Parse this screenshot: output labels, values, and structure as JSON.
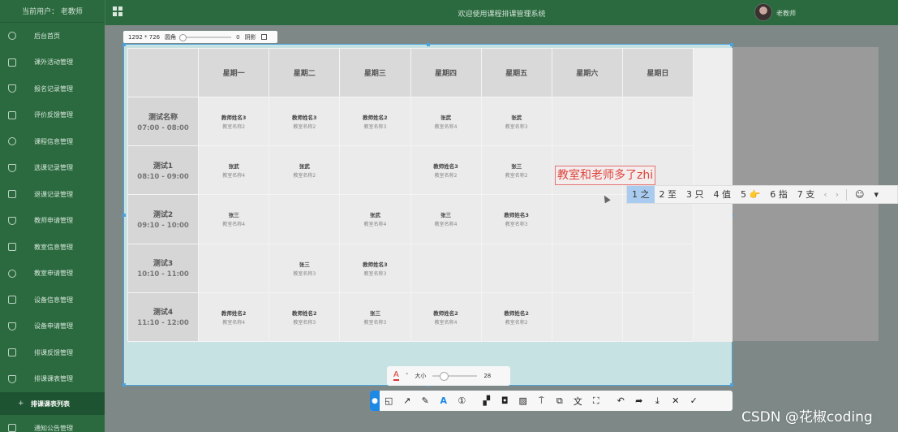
{
  "sidebar": {
    "current_user_label": "当前用户：  老教师",
    "items": [
      {
        "label": "后台首页",
        "icon": "home-icon"
      },
      {
        "label": "课外活动管理",
        "icon": "doc-icon"
      },
      {
        "label": "报名记录管理",
        "icon": "shield-icon"
      },
      {
        "label": "评价反馈管理",
        "icon": "columns-icon"
      },
      {
        "label": "课程信息管理",
        "icon": "circle-icon"
      },
      {
        "label": "选课记录管理",
        "icon": "shield-icon"
      },
      {
        "label": "退课记录管理",
        "icon": "doc-icon"
      },
      {
        "label": "教师申请管理",
        "icon": "shield-icon"
      },
      {
        "label": "教室信息管理",
        "icon": "columns-icon"
      },
      {
        "label": "教室申请管理",
        "icon": "circle-icon"
      },
      {
        "label": "设备信息管理",
        "icon": "columns-icon"
      },
      {
        "label": "设备申请管理",
        "icon": "shield-icon"
      },
      {
        "label": "排课反馈管理",
        "icon": "doc-icon"
      },
      {
        "label": "排课课表管理",
        "icon": "shield-icon"
      }
    ],
    "sub_item": {
      "prefix": "+",
      "label": "排课课表列表"
    },
    "last_item": {
      "label": "通知公告管理",
      "icon": "columns-icon"
    }
  },
  "topbar": {
    "title": "欢迎使用课程排课管理系统",
    "user": "老教师"
  },
  "sizebar": {
    "dimensions": "1292 * 726",
    "radius_label": "圆角",
    "radius_value": "0",
    "shadow_label": "阴影"
  },
  "schedule": {
    "days": [
      "星期一",
      "星期二",
      "星期三",
      "星期四",
      "星期五",
      "星期六",
      "星期日"
    ],
    "rows": [
      {
        "name": "测试名称",
        "time": "07:00 - 08:00",
        "cells": [
          {
            "teacher": "教师姓名3",
            "room": "教室名称2"
          },
          {
            "teacher": "教师姓名3",
            "room": "教室名称2"
          },
          {
            "teacher": "教师姓名2",
            "room": "教室名称3"
          },
          {
            "teacher": "张武",
            "room": "教室名称4"
          },
          {
            "teacher": "张武",
            "room": "教室名称3"
          },
          {
            "teacher": "",
            "room": ""
          },
          {
            "teacher": "",
            "room": ""
          }
        ]
      },
      {
        "name": "测试1",
        "time": "08:10 - 09:00",
        "cells": [
          {
            "teacher": "张武",
            "room": "教室名称4"
          },
          {
            "teacher": "张武",
            "room": "教室名称2"
          },
          {
            "teacher": "",
            "room": ""
          },
          {
            "teacher": "教师姓名3",
            "room": "教室名称2"
          },
          {
            "teacher": "张三",
            "room": "教室名称2"
          },
          {
            "teacher": "",
            "room": ""
          },
          {
            "teacher": "",
            "room": ""
          }
        ]
      },
      {
        "name": "测试2",
        "time": "09:10 - 10:00",
        "cells": [
          {
            "teacher": "张三",
            "room": "教室名称4"
          },
          {
            "teacher": "",
            "room": ""
          },
          {
            "teacher": "张武",
            "room": "教室名称4"
          },
          {
            "teacher": "张三",
            "room": "教室名称4"
          },
          {
            "teacher": "教师姓名3",
            "room": "教室名称3"
          },
          {
            "teacher": "",
            "room": ""
          },
          {
            "teacher": "",
            "room": ""
          }
        ]
      },
      {
        "name": "测试3",
        "time": "10:10 - 11:00",
        "cells": [
          {
            "teacher": "",
            "room": ""
          },
          {
            "teacher": "张三",
            "room": "教室名称3"
          },
          {
            "teacher": "教师姓名3",
            "room": "教室名称3"
          },
          {
            "teacher": "",
            "room": ""
          },
          {
            "teacher": "",
            "room": ""
          },
          {
            "teacher": "",
            "room": ""
          },
          {
            "teacher": "",
            "room": ""
          }
        ]
      },
      {
        "name": "测试4",
        "time": "11:10 - 12:00",
        "cells": [
          {
            "teacher": "教师姓名2",
            "room": "教室名称4"
          },
          {
            "teacher": "教师姓名2",
            "room": "教室名称3"
          },
          {
            "teacher": "张三",
            "room": "教室名称3"
          },
          {
            "teacher": "教师姓名2",
            "room": "教室名称4"
          },
          {
            "teacher": "教师姓名2",
            "room": "教室名称2"
          },
          {
            "teacher": "",
            "room": ""
          },
          {
            "teacher": "",
            "room": ""
          }
        ]
      }
    ]
  },
  "annotation": {
    "typed_text": "教室和老师多了zhi"
  },
  "ime": {
    "candidates": [
      "1 之",
      "2 至",
      "3 只",
      "4 值",
      "5 👉",
      "6 指",
      "7 支"
    ],
    "prev": "‹",
    "next": "›",
    "emoji": "☺",
    "menu": "▾"
  },
  "fontbar": {
    "color_label": "A",
    "size_label": "大小",
    "size_value": "28"
  },
  "tools": [
    {
      "name": "pin-icon",
      "glyph": "●"
    },
    {
      "name": "shape-icon",
      "glyph": "◱"
    },
    {
      "name": "arrow-icon",
      "glyph": "↗"
    },
    {
      "name": "pen-icon",
      "glyph": "✎"
    },
    {
      "name": "text-icon",
      "glyph": "A"
    },
    {
      "name": "number-icon",
      "glyph": "①"
    },
    {
      "name": "mosaic-icon",
      "glyph": "▞"
    },
    {
      "name": "blur-icon",
      "glyph": "◘"
    },
    {
      "name": "hatch-icon",
      "glyph": "▨"
    },
    {
      "name": "stamp-icon",
      "glyph": "⍑"
    },
    {
      "name": "image-icon",
      "glyph": "⧉"
    },
    {
      "name": "translate-icon",
      "glyph": "文"
    },
    {
      "name": "ocr-icon",
      "glyph": "⛶"
    },
    {
      "name": "undo-icon",
      "glyph": "↶"
    },
    {
      "name": "share-icon",
      "glyph": "➦"
    },
    {
      "name": "download-icon",
      "glyph": "⤓"
    },
    {
      "name": "close-icon",
      "glyph": "✕"
    },
    {
      "name": "confirm-icon",
      "glyph": "✓"
    }
  ],
  "watermark": "CSDN @花椒coding"
}
